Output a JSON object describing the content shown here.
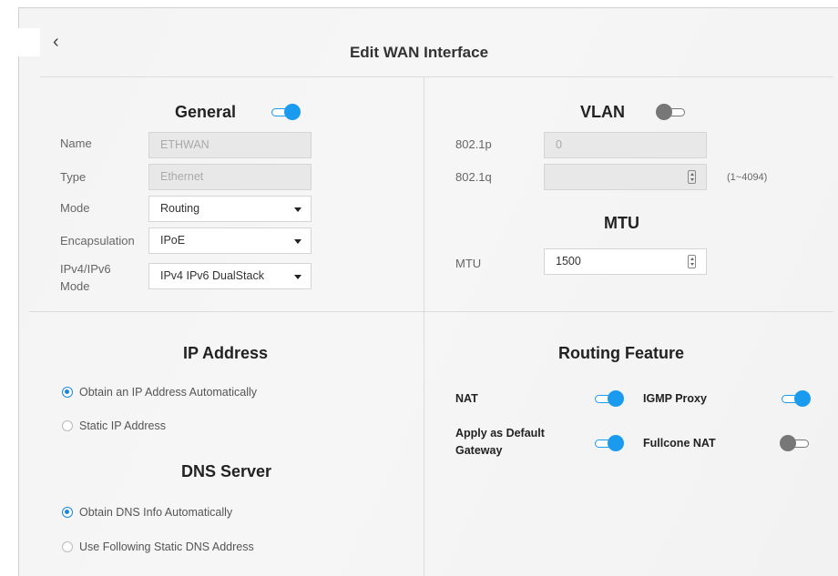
{
  "header": {
    "title": "Edit WAN Interface",
    "back_icon": "chevron-left-icon"
  },
  "general": {
    "title": "General",
    "enabled": true,
    "name_label": "Name",
    "name_value": "ETHWAN",
    "type_label": "Type",
    "type_value": "Ethernet",
    "mode_label": "Mode",
    "mode_value": "Routing",
    "encapsulation_label": "Encapsulation",
    "encapsulation_value": "IPoE",
    "ipmode_label_1": "IPv4/IPv6",
    "ipmode_label_2": "Mode",
    "ipmode_value": "IPv4 IPv6 DualStack"
  },
  "vlan": {
    "title": "VLAN",
    "enabled": false,
    "p_label": "802.1p",
    "p_value": "0",
    "q_label": "802.1q",
    "q_value": "",
    "q_hint": "(1~4094)"
  },
  "mtu": {
    "title": "MTU",
    "label": "MTU",
    "value": "1500"
  },
  "ip_address": {
    "title": "IP Address",
    "options": [
      {
        "label": "Obtain an IP Address Automatically",
        "checked": true
      },
      {
        "label": "Static IP Address",
        "checked": false
      }
    ]
  },
  "dns": {
    "title": "DNS Server",
    "options": [
      {
        "label": "Obtain DNS Info Automatically",
        "checked": true
      },
      {
        "label": "Use Following Static DNS Address",
        "checked": false
      }
    ]
  },
  "routing": {
    "title": "Routing Feature",
    "nat_label": "NAT",
    "nat_enabled": true,
    "igmp_label": "IGMP Proxy",
    "igmp_enabled": true,
    "gateway_label_1": "Apply as Default",
    "gateway_label_2": "Gateway",
    "gateway_enabled": true,
    "fullcone_label": "Fullcone NAT",
    "fullcone_enabled": false
  },
  "colors": {
    "accent": "#1a9bf0",
    "toggle_off": "#777777",
    "background": "#f4f4f4"
  }
}
